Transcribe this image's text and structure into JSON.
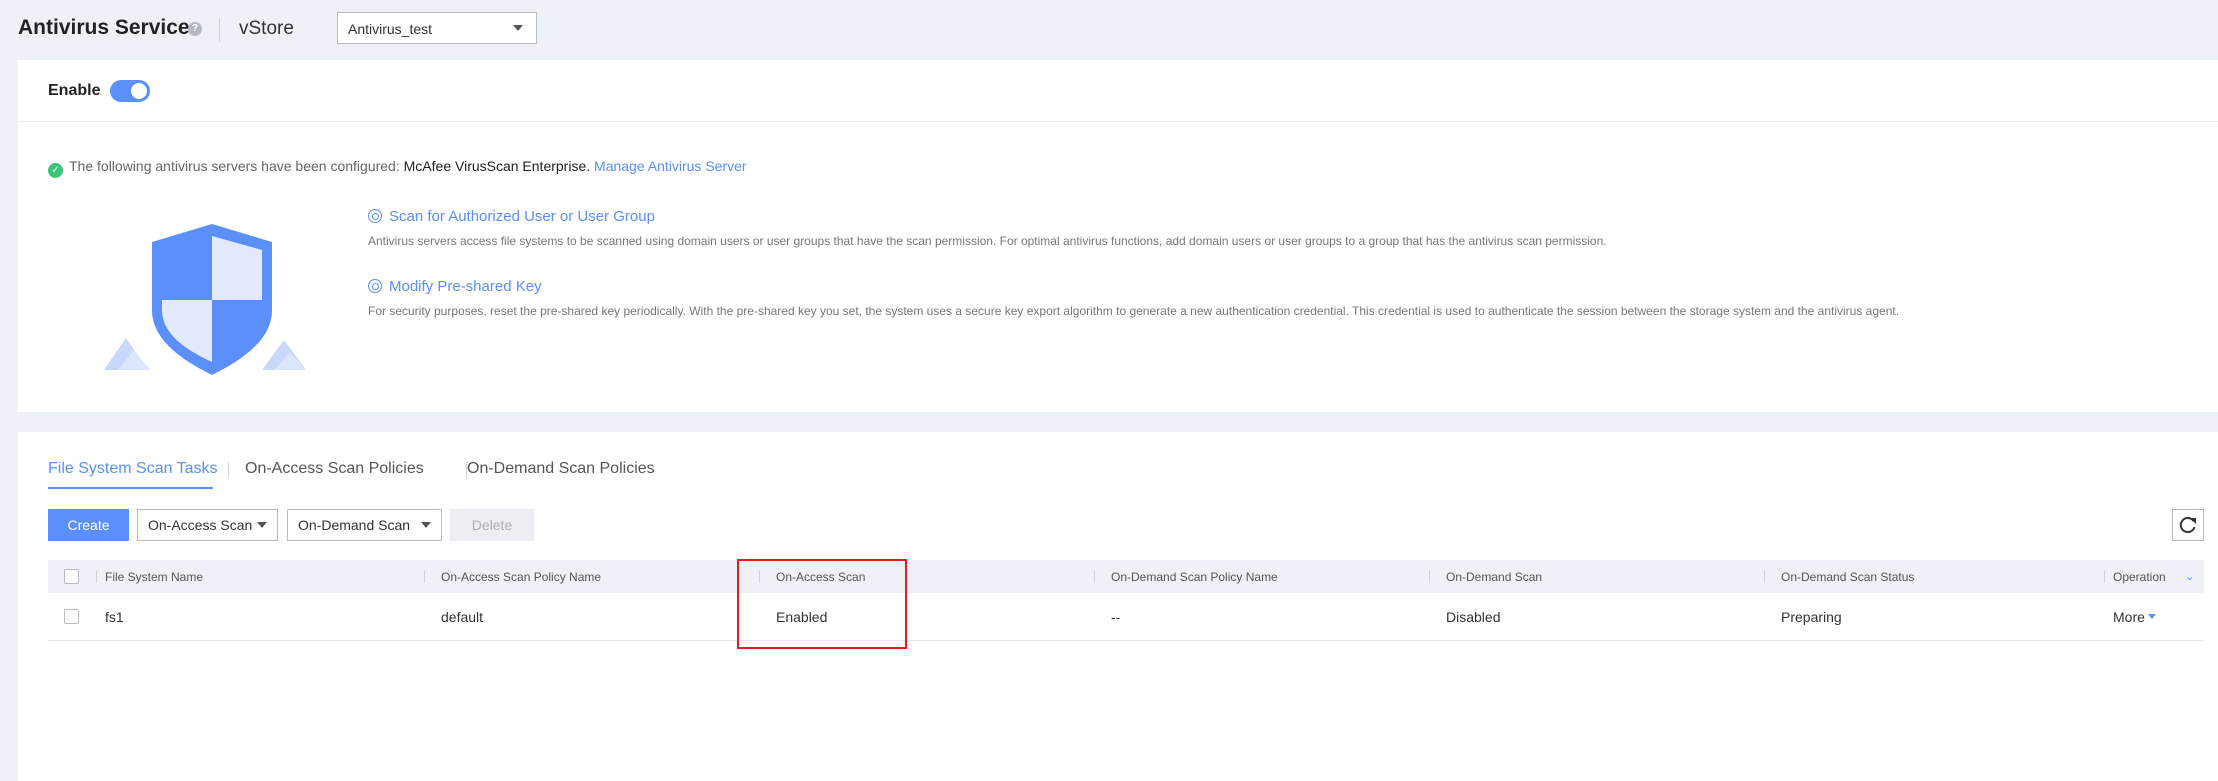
{
  "header": {
    "title": "Antivirus Service",
    "help_glyph": "?",
    "vstore_label": "vStore",
    "vstore_value": "Antivirus_test"
  },
  "config": {
    "enable_label": "Enable",
    "enabled": true,
    "status_prefix": "The following antivirus servers have been configured:",
    "server_name": "McAfee VirusScan Enterprise.",
    "manage_link": "Manage Antivirus Server",
    "features": [
      {
        "title": "Scan for Authorized User or User Group",
        "description": "Antivirus servers access file systems to be scanned using domain users or user groups that have the scan permission. For optimal antivirus functions, add domain users or user groups to a group that has the antivirus scan permission."
      },
      {
        "title": "Modify Pre-shared Key",
        "description": "For security purposes, reset the pre-shared key periodically. With the pre-shared key you set, the system uses a secure key export algorithm to generate a new authentication credential. This credential is used to authenticate the session between the storage system and the antivirus agent."
      }
    ]
  },
  "tasks": {
    "tabs": [
      "File System Scan Tasks",
      "On-Access Scan Policies",
      "On-Demand Scan Policies"
    ],
    "active_tab": 0,
    "toolbar": {
      "create": "Create",
      "on_access": "On-Access Scan",
      "on_demand": "On-Demand Scan",
      "delete": "Delete"
    },
    "table": {
      "columns": [
        "File System Name",
        "On-Access Scan Policy Name",
        "On-Access Scan",
        "On-Demand Scan Policy Name",
        "On-Demand Scan",
        "On-Demand Scan Status",
        "Operation"
      ],
      "rows": [
        {
          "fs_name": "fs1",
          "on_access_policy": "default",
          "on_access": "Enabled",
          "on_demand_policy": "--",
          "on_demand": "Disabled",
          "status": "Preparing",
          "operation": "More"
        }
      ]
    }
  },
  "colors": {
    "accent": "#5b8ff9",
    "success": "#3ec37a",
    "highlight": "#e02020"
  }
}
